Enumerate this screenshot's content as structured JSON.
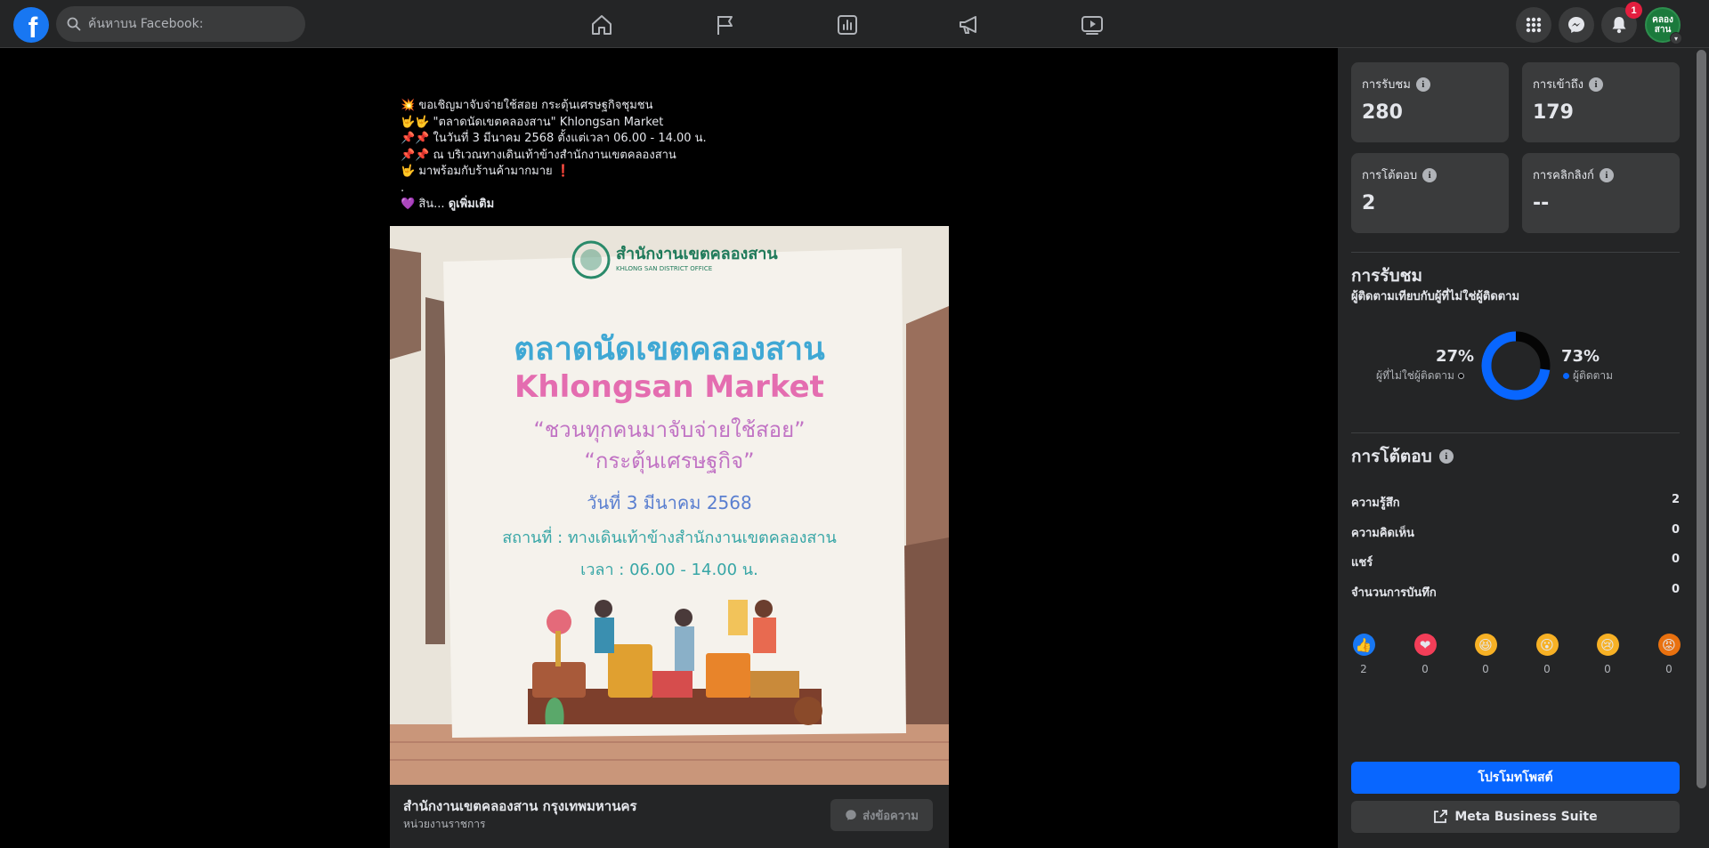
{
  "topbar": {
    "logo": "f",
    "search_placeholder": "ค้นหาบน Facebook:",
    "nav_icons": [
      "home-icon",
      "flag-icon",
      "chart-icon",
      "megaphone-icon",
      "video-icon"
    ],
    "right_icons": [
      "menu-grid-icon",
      "messenger-icon",
      "bell-icon"
    ],
    "notification_count": "1",
    "avatar_line1": "คลอง",
    "avatar_line2": "สาน"
  },
  "post": {
    "lines": [
      "💥 ขอเชิญมาจับจ่ายใช้สอย กระตุ้นเศรษฐกิจชุมชน",
      "🤟🤟 \"ตลาดนัดเขตคลองสาน\" Khlongsan Market",
      "📌📌 ในวันที่ 3 มีนาคม 2568 ตั้งแต่เวลา 06.00 - 14.00 น.",
      "📌📌 ณ บริเวณทางเดินเท้าข้างสำนักงานเขตคลองสาน",
      "🤟 มาพร้อมกับร้านค้ามากมาย ❗",
      "."
    ],
    "last_line_prefix": "💜 สิน...",
    "see_more": "ดูเพิ่มเติม",
    "image": {
      "office_th": "สำนักงานเขตคลองสาน",
      "office_en": "KHLONG SAN DISTRICT OFFICE",
      "title_th": "ตลาดนัดเขตคลองสาน",
      "title_en": "Khlongsan Market",
      "quote1": "“ชวนทุกคนมาจับจ่ายใช้สอย”",
      "quote2": "“กระตุ้นเศรษฐกิจ”",
      "date": "วันที่ 3 มีนาคม 2568",
      "place": "สถานที่ : ทางเดินเท้าข้างสำนักงานเขตคลองสาน",
      "time": "เวลา : 06.00 - 14.00 น."
    },
    "page_name": "สำนักงานเขตคลองสาน กรุงเทพมหานคร",
    "page_category": "หน่วยงานราชการ",
    "message_button": "ส่งข้อความ"
  },
  "insights": {
    "cards": [
      {
        "label": "การรับชม",
        "value": "280"
      },
      {
        "label": "การเข้าถึง",
        "value": "179"
      },
      {
        "label": "การโต้ตอบ",
        "value": "2"
      },
      {
        "label": "การคลิกลิงก์",
        "value": "--"
      }
    ],
    "views_title": "การรับชม",
    "views_subtitle": "ผู้ติดตามเทียบกับผู้ที่ไม่ใช่ผู้ติดตาม",
    "non_follower_pct": "27%",
    "non_follower_label": "ผู้ที่ไม่ใช่ผู้ติดตาม",
    "follower_pct": "73%",
    "follower_label": "ผู้ติดตาม",
    "follower_fraction": 0.73,
    "colors": {
      "follower": "#0866ff",
      "non_follower": "#050505",
      "accent": "#0866ff"
    },
    "engagement_title": "การโต้ตอบ",
    "engagement_rows": [
      {
        "label": "ความรู้สึก",
        "value": "2"
      },
      {
        "label": "ความคิดเห็น",
        "value": "0"
      },
      {
        "label": "แชร์",
        "value": "0"
      },
      {
        "label": "จำนวนการบันทึก",
        "value": "0"
      }
    ],
    "reactions": [
      {
        "name": "like-reaction-icon",
        "emoji": "👍",
        "bg": "#1877f2",
        "count": "2"
      },
      {
        "name": "love-reaction-icon",
        "emoji": "❤",
        "bg": "#f33e58",
        "count": "0"
      },
      {
        "name": "haha-reaction-icon",
        "emoji": "😆",
        "bg": "#f7b125",
        "count": "0"
      },
      {
        "name": "wow-reaction-icon",
        "emoji": "😮",
        "bg": "#f7b125",
        "count": "0"
      },
      {
        "name": "sad-reaction-icon",
        "emoji": "😢",
        "bg": "#f7b125",
        "count": "0"
      },
      {
        "name": "angry-reaction-icon",
        "emoji": "😡",
        "bg": "#e9710f",
        "count": "0"
      }
    ],
    "promote_button": "โปรโมทโพสต์",
    "mbs_button": "Meta Business Suite"
  }
}
